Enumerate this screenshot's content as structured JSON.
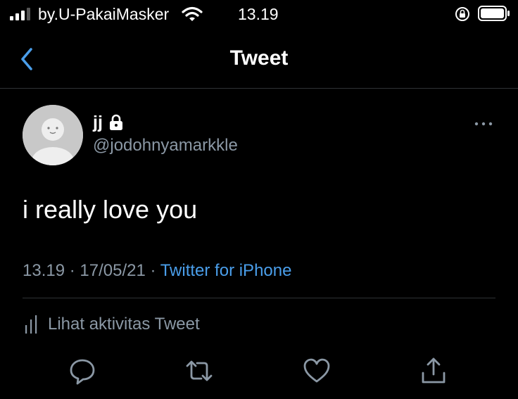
{
  "status_bar": {
    "carrier": "by.U-PakaiMasker",
    "time": "13.19",
    "icons": [
      "signal-icon",
      "wifi-icon",
      "orientation-lock-icon",
      "battery-icon"
    ]
  },
  "nav": {
    "title": "Tweet",
    "back_icon": "chevron-left-icon"
  },
  "tweet": {
    "author_name": "jj",
    "author_handle": "@jodohnyamarkkle",
    "protected_icon": "lock-icon",
    "text": "i really love you",
    "timestamp": "13.19 · 17/05/21 · ",
    "source": "Twitter for iPhone",
    "activity_label": "Lihat aktivitas Tweet",
    "actions": [
      "reply-icon",
      "retweet-icon",
      "like-icon",
      "share-icon"
    ]
  },
  "colors": {
    "background": "#000000",
    "text": "#ffffff",
    "secondary_text": "#8b98a5",
    "accent": "#4a9eea",
    "divider": "#2f3336"
  }
}
